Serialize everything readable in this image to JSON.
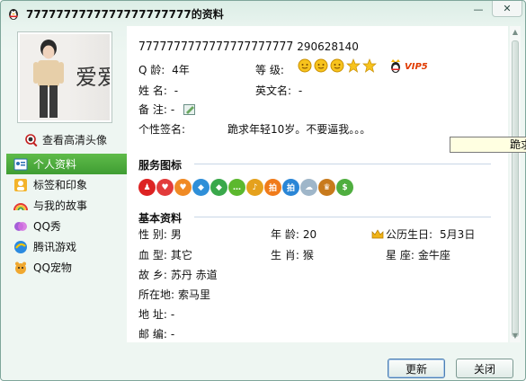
{
  "window": {
    "title": "7777777777777777777777的资料",
    "minimize_glyph": "—",
    "close_glyph": "✕"
  },
  "sidebar": {
    "avatar_text": "爱爱",
    "view_hd_label": "查看高清头像",
    "items": [
      {
        "label": "个人资料",
        "icon": "profile-card-icon",
        "active": true
      },
      {
        "label": "标签和印象",
        "icon": "tag-person-icon",
        "active": false
      },
      {
        "label": "与我的故事",
        "icon": "rainbow-icon",
        "active": false
      },
      {
        "label": "QQ秀",
        "icon": "qqshow-icon",
        "active": false
      },
      {
        "label": "腾讯游戏",
        "icon": "games-icon",
        "active": false
      },
      {
        "label": "QQ宠物",
        "icon": "pet-icon",
        "active": false
      }
    ]
  },
  "profile": {
    "nickname": "7777777777777777777777",
    "qq_number": "290628140",
    "age_label": "Q  龄:",
    "age_value": "4年",
    "level_label": "等  级:",
    "vip_badge": "VIP5",
    "name_label": "姓  名:",
    "name_value": "-",
    "english_name_label": "英文名:",
    "english_name_value": "-",
    "remark_label": "备  注:",
    "remark_value": "-",
    "signature_label": "个性签名:",
    "signature_value": "跪求年轻10岁。不要逼我。。。"
  },
  "services": {
    "title": "服务图标",
    "icons": [
      "penguin-icon",
      "heart-red-icon",
      "heart-orange-icon",
      "diamond-blue-icon",
      "diamond-green-icon",
      "chat-bubble-icon",
      "music-icon",
      "bid-orange-icon",
      "bid-blue-icon",
      "cloud-icon",
      "trophy-icon",
      "coins-icon"
    ]
  },
  "basic": {
    "title": "基本资料",
    "gender_label": "性  别:",
    "gender_value": "男",
    "age2_label": "年  龄:",
    "age2_value": "20",
    "birthday_label": "公历生日:",
    "birthday_value": "5月3日",
    "blood_label": "血  型:",
    "blood_value": "其它",
    "zodiac_label": "生  肖:",
    "zodiac_value": "猴",
    "constellation_label": "星    座:",
    "constellation_value": "金牛座",
    "hometown_label": "故  乡:",
    "hometown_value": "苏丹 赤道",
    "location_label": "所在地:",
    "location_value": "索马里",
    "address_label": "地  址:",
    "address_value": "-",
    "postcode_label": "邮  编:",
    "postcode_value": "-"
  },
  "tooltip": {
    "text": "跪求"
  },
  "buttons": {
    "refresh": "更新",
    "close": "关闭"
  }
}
